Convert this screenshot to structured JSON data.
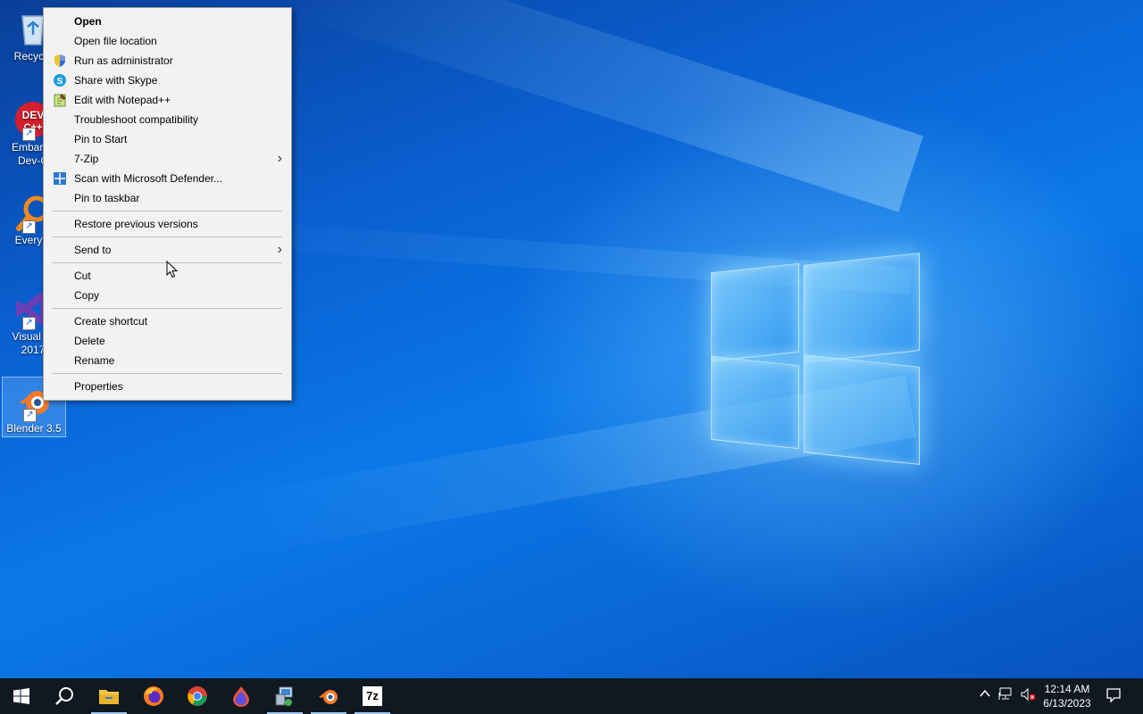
{
  "desktop": {
    "icons": [
      {
        "label": "Recycle"
      },
      {
        "label": "Embarca\nDev-C"
      },
      {
        "label": "Everyth"
      },
      {
        "label": "Visual St\n2017"
      },
      {
        "label": "Blender 3.5"
      }
    ]
  },
  "context_menu": {
    "items": [
      {
        "label": "Open"
      },
      {
        "label": "Open file location"
      },
      {
        "label": "Run as administrator"
      },
      {
        "label": "Share with Skype"
      },
      {
        "label": "Edit with Notepad++"
      },
      {
        "label": "Troubleshoot compatibility"
      },
      {
        "label": "Pin to Start"
      },
      {
        "label": "7-Zip"
      },
      {
        "label": "Scan with Microsoft Defender..."
      },
      {
        "label": "Pin to taskbar"
      },
      {
        "label": "Restore previous versions"
      },
      {
        "label": "Send to"
      },
      {
        "label": "Cut"
      },
      {
        "label": "Copy"
      },
      {
        "label": "Create shortcut"
      },
      {
        "label": "Delete"
      },
      {
        "label": "Rename"
      },
      {
        "label": "Properties"
      }
    ]
  },
  "taskbar": {
    "apps": [
      {
        "icon": "windows-start-icon"
      },
      {
        "icon": "search-icon"
      },
      {
        "icon": "file-explorer-icon"
      },
      {
        "icon": "firefox-icon"
      },
      {
        "icon": "chrome-icon"
      },
      {
        "icon": "app-drop-icon"
      },
      {
        "icon": "network-setup-icon"
      },
      {
        "icon": "blender-icon"
      },
      {
        "icon": "7zip-icon",
        "label": "7z"
      }
    ],
    "clock": {
      "time": "12:14 AM",
      "date": "6/13/2023"
    }
  },
  "colors": {
    "taskbar_bg": "#101820",
    "menu_bg": "#f2f2f2",
    "desktop_accent": "#0b78e8"
  }
}
